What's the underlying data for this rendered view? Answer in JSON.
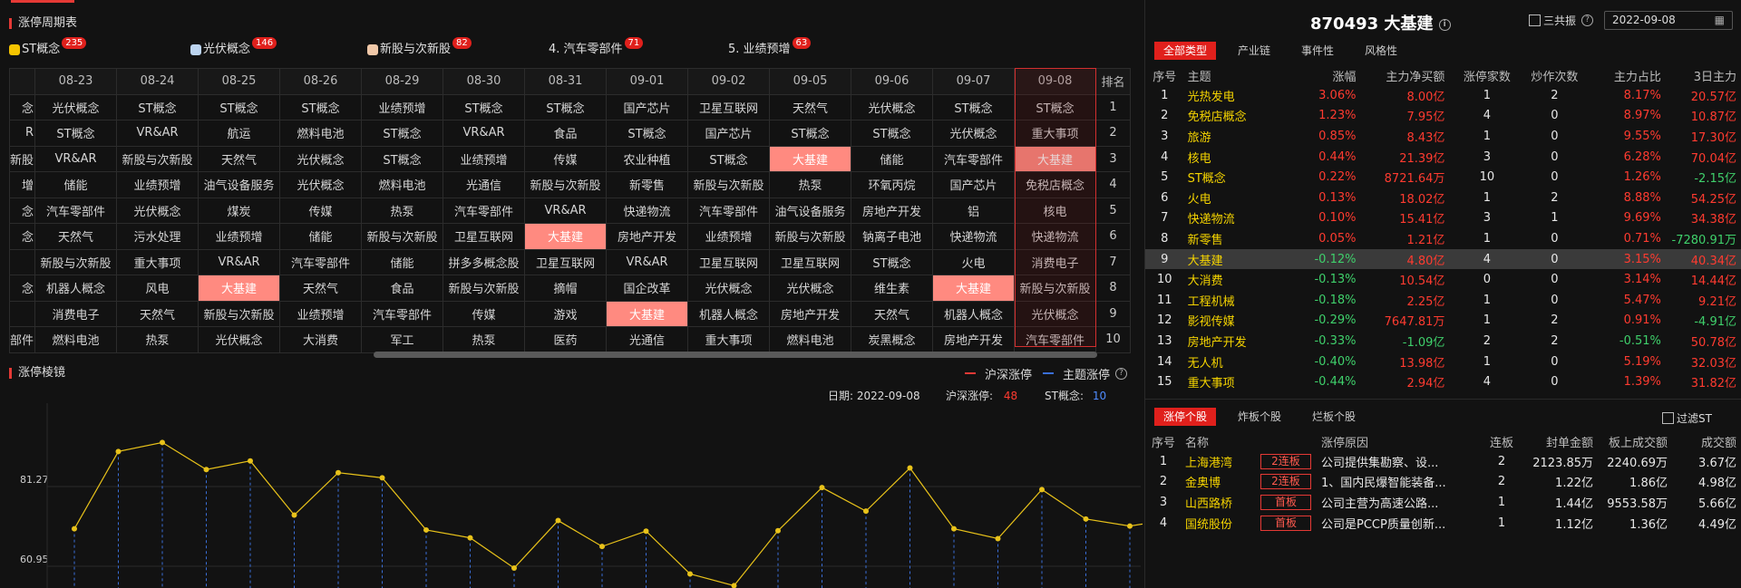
{
  "periodic": {
    "title": "涨停周期表",
    "tags": [
      {
        "name": "ST概念",
        "count": "235",
        "color": "#f5c400"
      },
      {
        "name": "光伏概念",
        "count": "146",
        "color": "#bcd4f0"
      },
      {
        "name": "新股与次新股",
        "count": "82",
        "color": "#f0c8a8"
      },
      {
        "name": "4. 汽车零部件",
        "count": "71",
        "color": ""
      },
      {
        "name": "5. 业绩预增",
        "count": "63",
        "color": ""
      }
    ],
    "dates": [
      "08-23",
      "08-24",
      "08-25",
      "08-26",
      "08-29",
      "08-30",
      "08-31",
      "09-01",
      "09-02",
      "09-05",
      "09-06",
      "09-07",
      "09-08"
    ],
    "rank_header": "排名",
    "left_clip": [
      "念",
      "R",
      "新股",
      "增",
      "念",
      "念",
      "",
      "念",
      "",
      "部件"
    ],
    "rows": [
      [
        "光伏概念",
        "ST概念",
        "ST概念",
        "ST概念",
        "业绩预增",
        "ST概念",
        "ST概念",
        "国产芯片",
        "卫星互联网",
        "天然气",
        "光伏概念",
        "ST概念",
        "ST概念",
        "1"
      ],
      [
        "ST概念",
        "VR&AR",
        "航运",
        "燃料电池",
        "ST概念",
        "VR&AR",
        "食品",
        "ST概念",
        "国产芯片",
        "ST概念",
        "ST概念",
        "光伏概念",
        "重大事项",
        "2"
      ],
      [
        "VR&AR",
        "新股与次新股",
        "天然气",
        "光伏概念",
        "ST概念",
        "业绩预增",
        "传媒",
        "农业种植",
        "ST概念",
        "大基建",
        "储能",
        "汽车零部件",
        "大基建",
        "3"
      ],
      [
        "储能",
        "业绩预增",
        "油气设备服务",
        "光伏概念",
        "燃料电池",
        "光通信",
        "新股与次新股",
        "新零售",
        "新股与次新股",
        "热泵",
        "环氧丙烷",
        "国产芯片",
        "免税店概念",
        "4"
      ],
      [
        "汽车零部件",
        "光伏概念",
        "煤炭",
        "传媒",
        "热泵",
        "汽车零部件",
        "VR&AR",
        "快递物流",
        "汽车零部件",
        "油气设备服务",
        "房地产开发",
        "铝",
        "核电",
        "5"
      ],
      [
        "天然气",
        "污水处理",
        "业绩预增",
        "储能",
        "新股与次新股",
        "卫星互联网",
        "大基建",
        "房地产开发",
        "业绩预增",
        "新股与次新股",
        "钠离子电池",
        "快递物流",
        "快递物流",
        "6"
      ],
      [
        "新股与次新股",
        "重大事项",
        "VR&AR",
        "汽车零部件",
        "储能",
        "拼多多概念股",
        "卫星互联网",
        "VR&AR",
        "卫星互联网",
        "卫星互联网",
        "ST概念",
        "火电",
        "消费电子",
        "7"
      ],
      [
        "机器人概念",
        "风电",
        "大基建",
        "天然气",
        "食品",
        "新股与次新股",
        "摘帽",
        "国企改革",
        "光伏概念",
        "光伏概念",
        "维生素",
        "大基建",
        "新股与次新股",
        "8"
      ],
      [
        "消费电子",
        "天然气",
        "新股与次新股",
        "业绩预增",
        "汽车零部件",
        "传媒",
        "游戏",
        "大基建",
        "机器人概念",
        "房地产开发",
        "天然气",
        "机器人概念",
        "光伏概念",
        "9"
      ],
      [
        "燃料电池",
        "热泵",
        "光伏概念",
        "大消费",
        "军工",
        "热泵",
        "医药",
        "光通信",
        "重大事项",
        "燃料电池",
        "炭黑概念",
        "房地产开发",
        "汽车零部件",
        "10"
      ]
    ],
    "highlight": "大基建"
  },
  "mirror": {
    "title": "涨停棱镜",
    "legend": [
      {
        "label": "沪深涨停",
        "color": "#e53935"
      },
      {
        "label": "主题涨停",
        "color": "#3a6fd8"
      }
    ],
    "info": {
      "date_label": "日期:",
      "date_value": "2022-09-08",
      "hs_label": "沪深涨停:",
      "hs_value": "48",
      "st_label": "ST概念:",
      "st_value": "10"
    }
  },
  "chart_data": {
    "type": "line",
    "title": "",
    "yticks": [
      81.27,
      60.95
    ],
    "series": [
      {
        "name": "",
        "color": "#e8c21a",
        "values": [
          70.5,
          90.2,
          92.5,
          85.6,
          87.8,
          74.0,
          84.8,
          83.5,
          70.2,
          68.2,
          60.5,
          72.6,
          66.0,
          69.9,
          59.0,
          56.0,
          70.0,
          81.0,
          75.0,
          86.0,
          70.5,
          68.0,
          80.5,
          73.0,
          71.2,
          73.0,
          74.0,
          79.0
        ]
      }
    ]
  },
  "stock": {
    "title": "870493 大基建",
    "resonance_label": "三共振",
    "date": "2022-09-08",
    "tabs": [
      "全部类型",
      "产业链",
      "事件性",
      "风格性"
    ],
    "headers": [
      "序号",
      "主题",
      "涨幅",
      "主力净买额",
      "涨停家数",
      "炒作次数",
      "主力占比",
      "3日主力"
    ],
    "rows": [
      [
        "1",
        "光热发电",
        "3.06%",
        "8.00亿",
        "1",
        "2",
        "8.17%",
        "20.57亿"
      ],
      [
        "2",
        "免税店概念",
        "1.23%",
        "7.95亿",
        "4",
        "0",
        "8.97%",
        "10.87亿"
      ],
      [
        "3",
        "旅游",
        "0.85%",
        "8.43亿",
        "1",
        "0",
        "9.55%",
        "17.30亿"
      ],
      [
        "4",
        "核电",
        "0.44%",
        "21.39亿",
        "3",
        "0",
        "6.28%",
        "70.04亿"
      ],
      [
        "5",
        "ST概念",
        "0.22%",
        "8721.64万",
        "10",
        "0",
        "1.26%",
        "-2.15亿"
      ],
      [
        "6",
        "火电",
        "0.13%",
        "18.02亿",
        "1",
        "2",
        "8.88%",
        "54.25亿"
      ],
      [
        "7",
        "快递物流",
        "0.10%",
        "15.41亿",
        "3",
        "1",
        "9.69%",
        "34.38亿"
      ],
      [
        "8",
        "新零售",
        "0.05%",
        "1.21亿",
        "1",
        "0",
        "0.71%",
        "-7280.91万"
      ],
      [
        "9",
        "大基建",
        "-0.12%",
        "4.80亿",
        "4",
        "0",
        "3.15%",
        "40.34亿"
      ],
      [
        "10",
        "大消费",
        "-0.13%",
        "10.54亿",
        "0",
        "0",
        "3.14%",
        "14.44亿"
      ],
      [
        "11",
        "工程机械",
        "-0.18%",
        "2.25亿",
        "1",
        "0",
        "5.47%",
        "9.21亿"
      ],
      [
        "12",
        "影视传媒",
        "-0.29%",
        "7647.81万",
        "1",
        "2",
        "0.91%",
        "-4.91亿"
      ],
      [
        "13",
        "房地产开发",
        "-0.33%",
        "-1.09亿",
        "2",
        "2",
        "-0.51%",
        "50.78亿"
      ],
      [
        "14",
        "无人机",
        "-0.40%",
        "13.98亿",
        "1",
        "0",
        "5.19%",
        "32.03亿"
      ],
      [
        "15",
        "重大事项",
        "-0.44%",
        "2.94亿",
        "4",
        "0",
        "1.39%",
        "31.82亿"
      ]
    ],
    "selected_row": 8
  },
  "limitup": {
    "tabs": [
      "涨停个股",
      "炸板个股",
      "烂板个股"
    ],
    "filter_label": "过滤ST",
    "headers": [
      "序号",
      "名称",
      "",
      "涨停原因",
      "连板",
      "封单金额",
      "板上成交额",
      "成交额"
    ],
    "rows": [
      [
        "1",
        "上海港湾",
        "2连板",
        "公司提供集勘察、设...",
        "2",
        "2123.85万",
        "2240.69万",
        "3.67亿"
      ],
      [
        "2",
        "金奥博",
        "2连板",
        "1、国内民爆智能装备...",
        "2",
        "1.22亿",
        "1.86亿",
        "4.98亿"
      ],
      [
        "3",
        "山西路桥",
        "首板",
        "公司主营为高速公路...",
        "1",
        "1.44亿",
        "9553.58万",
        "5.66亿"
      ],
      [
        "4",
        "国统股份",
        "首板",
        "公司是PCCP质量创新...",
        "1",
        "1.12亿",
        "1.36亿",
        "4.49亿"
      ]
    ]
  }
}
